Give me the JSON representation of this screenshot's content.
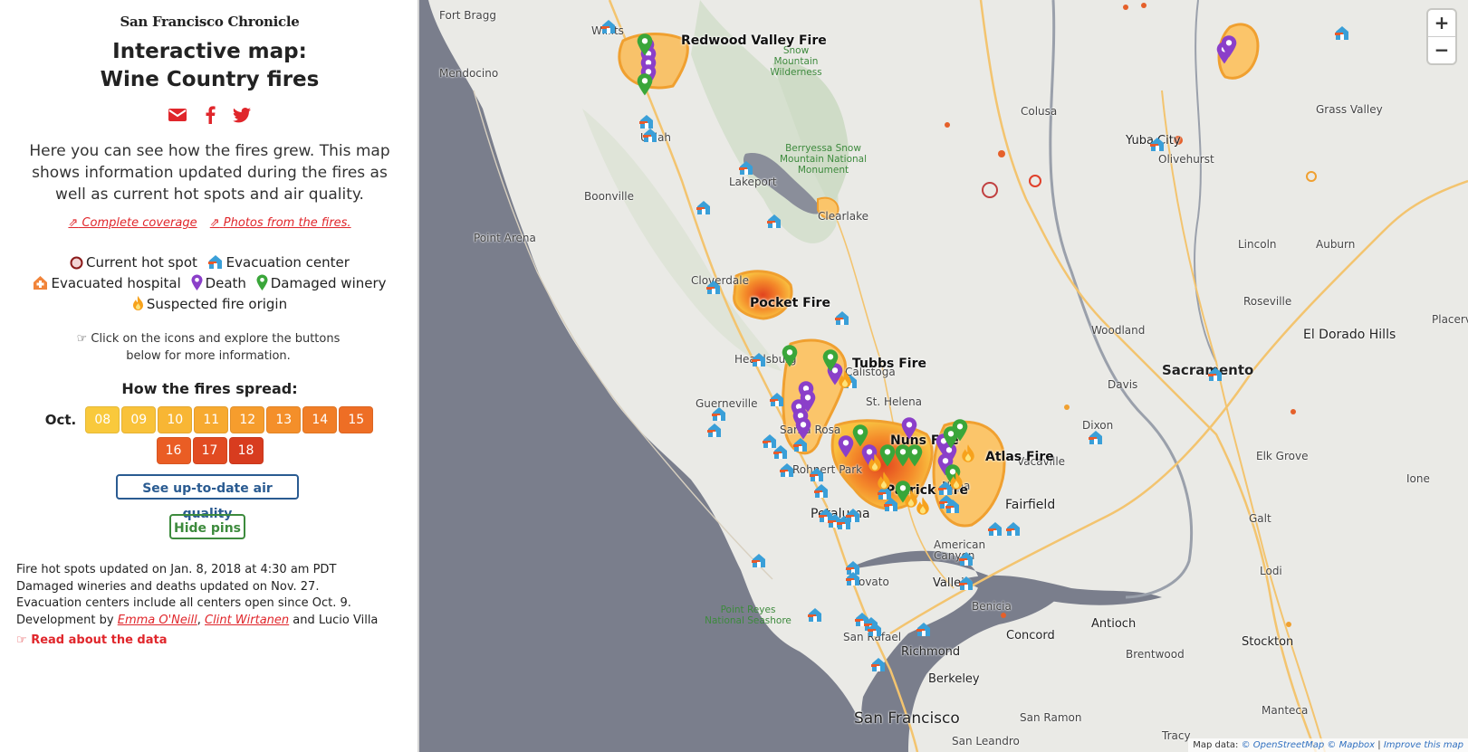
{
  "brand": "San Francisco Chronicle",
  "title_line1": "Interactive map:",
  "title_line2": "Wine Country fires",
  "share": {
    "email": "email-icon",
    "facebook": "facebook-icon",
    "twitter": "twitter-icon"
  },
  "intro": "Here you can see how the fires grew. This map shows information updated during the fires as well as current hot spots and air quality.",
  "links": {
    "coverage": "Complete coverage",
    "photos": "Photos from the fires."
  },
  "legend": {
    "hotspot": "Current hot spot",
    "evac_center": "Evacuation center",
    "evac_hospital": "Evacuated hospital",
    "death": "Death",
    "winery": "Damaged winery",
    "origin": "Suspected fire origin"
  },
  "hint": "Click on the icons and explore the buttons below for more information.",
  "spread": {
    "title": "How the fires spread:",
    "month": "Oct.",
    "days": [
      {
        "label": "08",
        "color": "#f9c93c"
      },
      {
        "label": "09",
        "color": "#f9c23a"
      },
      {
        "label": "10",
        "color": "#f8b634"
      },
      {
        "label": "11",
        "color": "#f7aa30"
      },
      {
        "label": "12",
        "color": "#f69d2d"
      },
      {
        "label": "13",
        "color": "#f48f2a"
      },
      {
        "label": "14",
        "color": "#f17e27"
      },
      {
        "label": "15",
        "color": "#ee6e25"
      },
      {
        "label": "16",
        "color": "#ea5d24"
      },
      {
        "label": "17",
        "color": "#e24b22"
      },
      {
        "label": "18",
        "color": "#d83c1f"
      }
    ]
  },
  "buttons": {
    "air": "See up-to-date air quality",
    "hide": "Hide pins"
  },
  "notes": {
    "line1": "Fire hot spots updated on Jan. 8, 2018 at 4:30 am PDT",
    "line2": "Damaged wineries and deaths updated on Nov. 27.",
    "line3": "Evacuation centers include all centers open since Oct. 9.",
    "dev_prefix": "Development by",
    "dev1": "Emma O'Neill",
    "dev_sep": ",",
    "dev2": "Clint Wirtanen",
    "dev_suffix": "and Lucio Villa",
    "read": "Read about the data"
  },
  "map": {
    "fires": [
      "Redwood Valley Fire",
      "Pocket Fire",
      "Tubbs Fire",
      "Nuns Fire",
      "Atlas Fire",
      "Patrick Fire"
    ],
    "places": [
      "Fort Bragg",
      "Willits",
      "Mendocino",
      "Ukiah",
      "Boonville",
      "Point Arena",
      "Lakeport",
      "Clearlake",
      "Cloverdale",
      "Healdsburg",
      "Guerneville",
      "Santa Rosa",
      "Rohnert Park",
      "Petaluma",
      "Napa",
      "St. Helena",
      "Calistoga",
      "Vacaville",
      "Fairfield",
      "Dixon",
      "Davis",
      "Woodland",
      "Sacramento",
      "El Dorado Hills",
      "Roseville",
      "Lincoln",
      "Auburn",
      "Grass Valley",
      "Yuba City",
      "Olivehurst",
      "Colusa",
      "Galt",
      "Lodi",
      "Stockton",
      "Antioch",
      "Concord",
      "Benicia",
      "Vallejo",
      "American Canyon",
      "Novato",
      "San Rafael",
      "Richmond",
      "Berkeley",
      "San Francisco",
      "San Ramon",
      "San Leandro",
      "Brentwood",
      "Manteca",
      "Tracy",
      "Ione",
      "Placerville",
      "Elk Grove"
    ],
    "parks": [
      "Snow Mountain Wilderness",
      "Berryessa Snow Mountain National Monument",
      "Point Reyes National Seashore"
    ],
    "zoom_in": "+",
    "zoom_out": "−",
    "attribution_prefix": "Map data:",
    "attribution_osm": "© OpenStreetMap",
    "attribution_mapbox": "© Mapbox",
    "attribution_sep": "|",
    "attribution_improve": "Improve this map"
  }
}
